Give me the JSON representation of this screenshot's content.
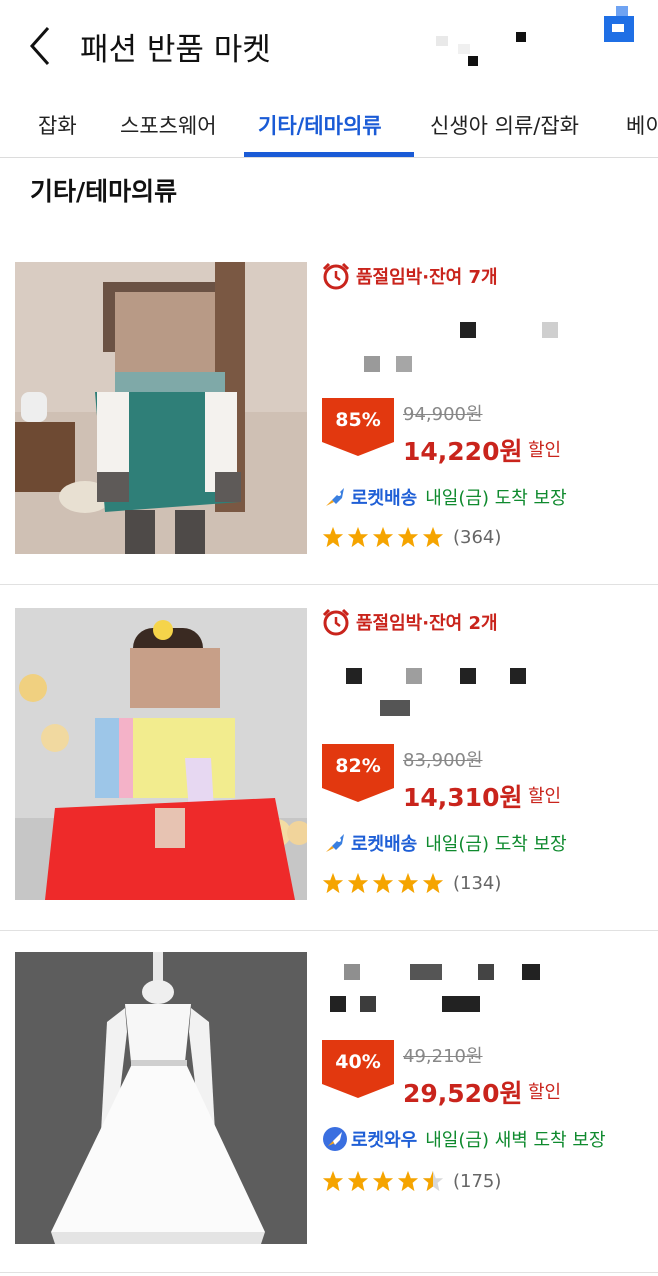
{
  "header": {
    "title": "패션 반품 마켓",
    "back_icon": "chevron-left-icon",
    "logo_color": "#1f6fe5"
  },
  "tabs": [
    {
      "label": "잡화",
      "active": false
    },
    {
      "label": "스포츠웨어",
      "active": false
    },
    {
      "label": "기타/테마의류",
      "active": true
    },
    {
      "label": "신생아 의류/잡화",
      "active": false
    },
    {
      "label": "베이",
      "active": false
    }
  ],
  "section_title": "기타/테마의류",
  "accent_color": "#1a5bd6",
  "price_color": "#c9241c",
  "products": [
    {
      "urgent_label": "품절임박·잔여 7개",
      "discount": "85%",
      "original_price": "94,900원",
      "sale_price": "14,220원",
      "sale_suffix": "할인",
      "delivery_brand": "로켓배송",
      "delivery_text": "내일(금) 도착 보장",
      "delivery_icon": "rocket-icon",
      "rating": 5,
      "review_count": "(364)",
      "image": "green-hanbok-boy"
    },
    {
      "urgent_label": "품절임박·잔여 2개",
      "discount": "82%",
      "original_price": "83,900원",
      "sale_price": "14,310원",
      "sale_suffix": "할인",
      "delivery_brand": "로켓배송",
      "delivery_text": "내일(금) 도착 보장",
      "delivery_icon": "rocket-icon",
      "rating": 5,
      "review_count": "(134)",
      "image": "yellow-red-hanbok-girl"
    },
    {
      "urgent_label": "",
      "discount": "40%",
      "original_price": "49,210원",
      "sale_price": "29,520원",
      "sale_suffix": "할인",
      "delivery_brand": "로켓와우",
      "delivery_text": "내일(금) 새벽 도착 보장",
      "delivery_icon": "rocket-wow-icon",
      "rating": 4.5,
      "review_count": "(175)",
      "image": "white-lace-dress"
    }
  ]
}
